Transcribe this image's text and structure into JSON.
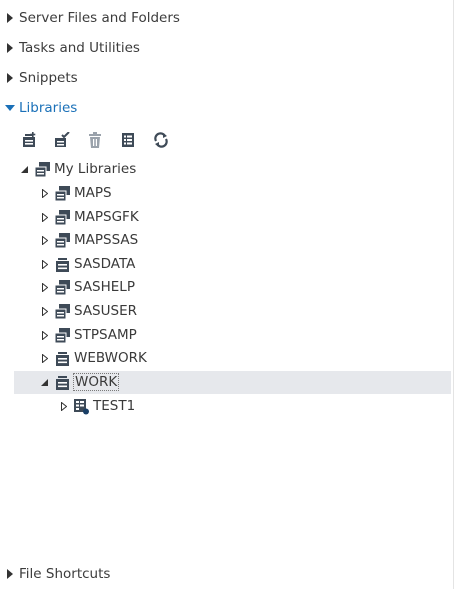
{
  "sections": {
    "server_files": "Server Files and Folders",
    "tasks": "Tasks and Utilities",
    "snippets": "Snippets",
    "libraries": "Libraries",
    "file_shortcuts": "File Shortcuts"
  },
  "toolbar": {
    "new_library_icon": "new-library-icon",
    "properties_icon": "library-properties-icon",
    "delete_icon": "delete-icon",
    "view_columns_icon": "view-columns-icon",
    "refresh_icon": "refresh-icon"
  },
  "tree": {
    "root": "My Libraries",
    "libraries": [
      {
        "name": "MAPS",
        "type": "readonly"
      },
      {
        "name": "MAPSGFK",
        "type": "readonly"
      },
      {
        "name": "MAPSSAS",
        "type": "readonly"
      },
      {
        "name": "SASDATA",
        "type": "standard"
      },
      {
        "name": "SASHELP",
        "type": "readonly"
      },
      {
        "name": "SASUSER",
        "type": "readonly"
      },
      {
        "name": "STPSAMP",
        "type": "readonly"
      },
      {
        "name": "WEBWORK",
        "type": "standard"
      },
      {
        "name": "WORK",
        "type": "standard"
      }
    ],
    "work_children": [
      {
        "name": "TEST1"
      }
    ]
  },
  "colors": {
    "accent": "#1a70b8",
    "icon": "#3e4a57",
    "selection": "#e6e8ec"
  }
}
